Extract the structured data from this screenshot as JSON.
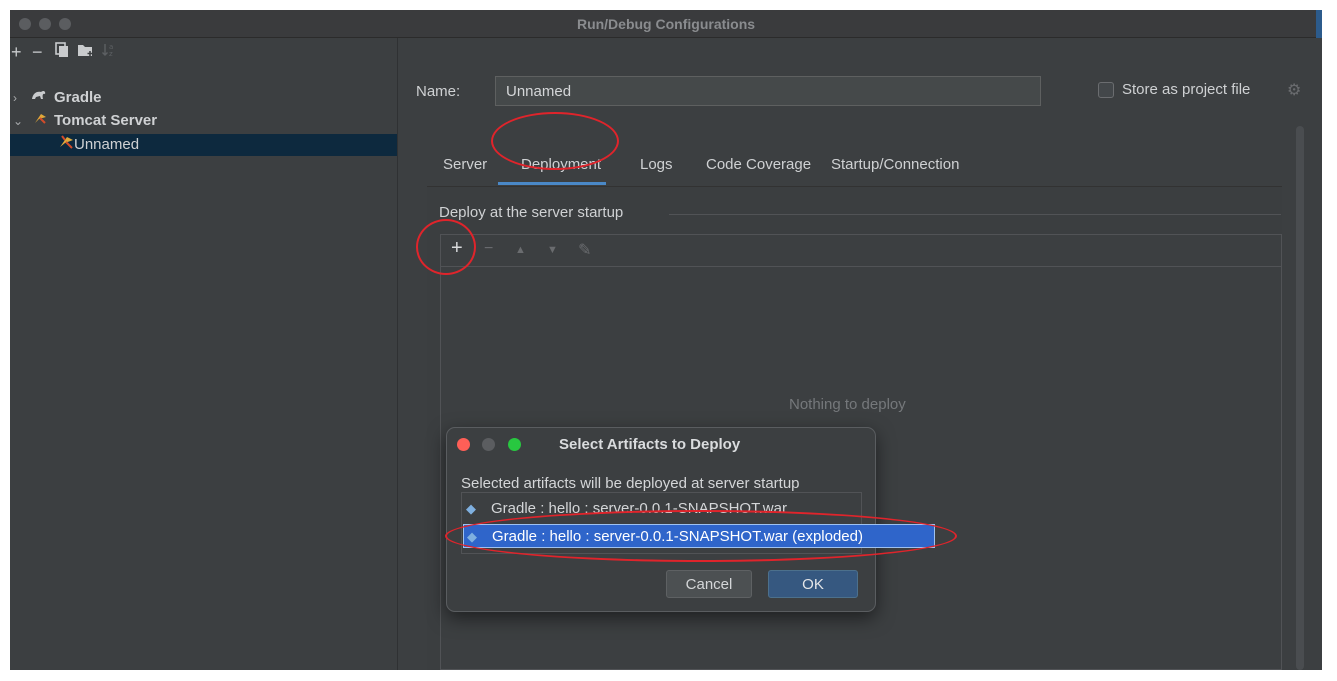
{
  "window": {
    "title": "Run/Debug Configurations"
  },
  "left_toolbar": {
    "add_label": "+",
    "remove_label": "−",
    "copy_icon": "copy-icon",
    "folder_icon": "new-folder-icon",
    "sort_icon": "sort-icon"
  },
  "tree": {
    "items": [
      {
        "label": "Gradle",
        "icon": "gradle-icon",
        "expanded": false
      },
      {
        "label": "Tomcat Server",
        "icon": "tomcat-icon",
        "expanded": true
      },
      {
        "label": "Unnamed",
        "icon": "tomcat-config-icon",
        "selected": true
      }
    ]
  },
  "config": {
    "name_label": "Name:",
    "name_value": "Unnamed",
    "store_label": "Store as project file",
    "store_checked": false
  },
  "tabs": [
    {
      "label": "Server"
    },
    {
      "label": "Deployment",
      "active": true
    },
    {
      "label": "Logs"
    },
    {
      "label": "Code Coverage"
    },
    {
      "label": "Startup/Connection"
    }
  ],
  "deployment": {
    "section_title": "Deploy at the server startup",
    "empty_text": "Nothing to deploy",
    "toolbar": {
      "add": "+",
      "remove": "−",
      "up": "▲",
      "down": "▼",
      "edit": "✎"
    }
  },
  "dialog": {
    "title": "Select Artifacts to Deploy",
    "description": "Selected artifacts will be deployed at server startup",
    "artifacts": [
      {
        "label": "Gradle : hello : server-0.0.1-SNAPSHOT.war",
        "selected": false
      },
      {
        "label": "Gradle : hello : server-0.0.1-SNAPSHOT.war (exploded)",
        "selected": true
      }
    ],
    "cancel_label": "Cancel",
    "ok_label": "OK"
  },
  "colors": {
    "background": "#3c3f41",
    "selection": "#2f65ca",
    "tab_underline": "#4a88c7",
    "annotation_red": "#e0242b",
    "tree_selection": "#0d293e"
  }
}
